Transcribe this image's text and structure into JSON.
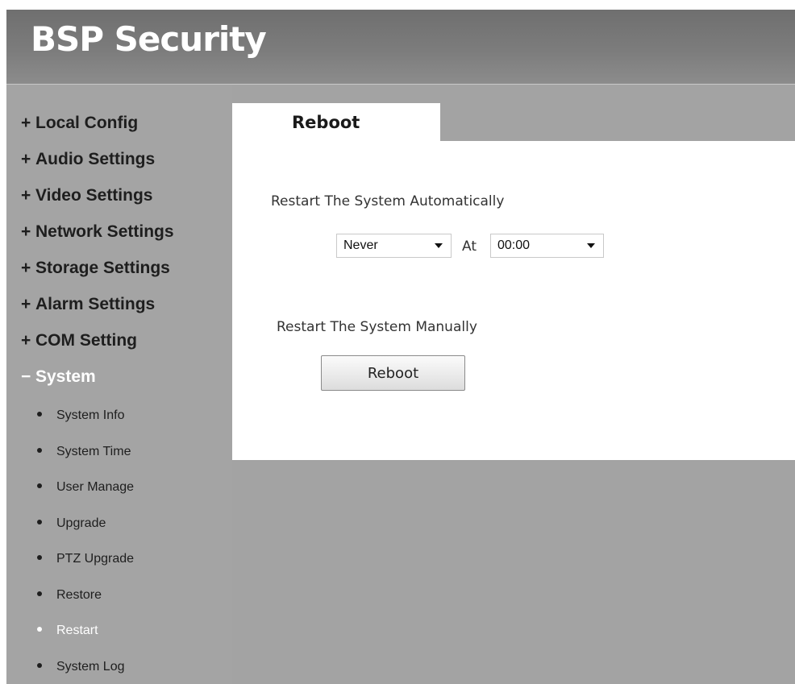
{
  "header": {
    "brand": "BSP Security"
  },
  "sidebar": {
    "menus": [
      {
        "sign": "+",
        "label": "Local Config"
      },
      {
        "sign": "+",
        "label": "Audio Settings"
      },
      {
        "sign": "+",
        "label": "Video Settings"
      },
      {
        "sign": "+",
        "label": "Network Settings"
      },
      {
        "sign": "+",
        "label": "Storage Settings"
      },
      {
        "sign": "+",
        "label": "Alarm Settings"
      },
      {
        "sign": "+",
        "label": "COM Setting"
      },
      {
        "sign": "−",
        "label": "System"
      }
    ],
    "system_items": [
      "System Info",
      "System Time",
      "User Manage",
      "Upgrade",
      "PTZ Upgrade",
      "Restore",
      "Restart",
      "System Log"
    ],
    "active_menu": "System",
    "current_item": "Restart"
  },
  "main": {
    "tab_label": "Reboot",
    "auto_label": "Restart The System Automatically",
    "frequency_value": "Never",
    "at_label": "At",
    "time_value": "00:00",
    "manual_label": "Restart The System Manually",
    "reboot_button": "Reboot"
  },
  "colors": {
    "page_background": "#a3a3a3",
    "active_text": "#ffffff",
    "panel_background": "#ffffff"
  }
}
